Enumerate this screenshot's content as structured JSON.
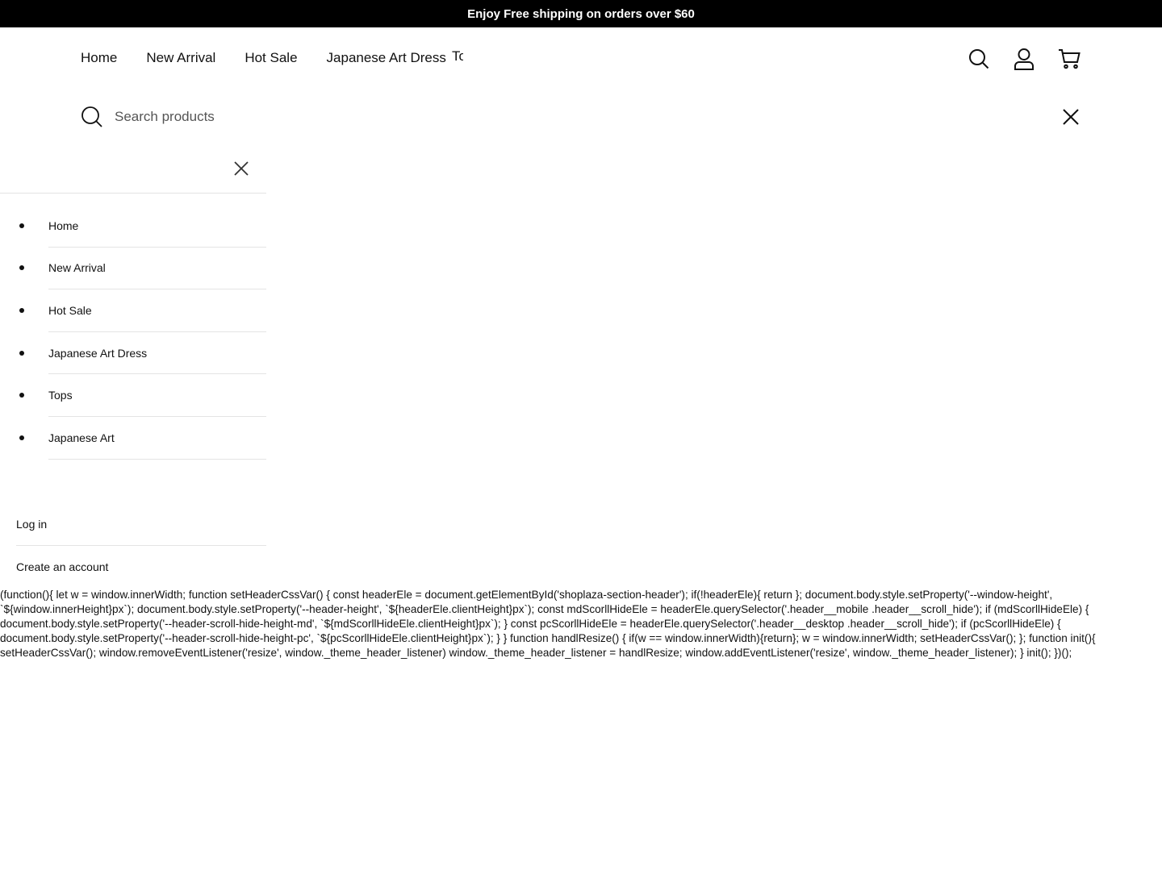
{
  "announcement": "Enjoy Free shipping on orders over $60",
  "nav": {
    "items": [
      "Home",
      "New Arrival",
      "Hot Sale",
      "Japanese Art Dress"
    ],
    "clipped_item": "Tops"
  },
  "header_icons": [
    "search-icon",
    "account-icon",
    "cart-icon"
  ],
  "search": {
    "placeholder": "Search products"
  },
  "drawer": {
    "menu": [
      "Home",
      "New Arrival",
      "Hot Sale",
      "Japanese Art Dress",
      "Tops",
      "Japanese Art"
    ],
    "account": {
      "login": "Log in",
      "register": "Create an account"
    }
  },
  "script_text": "(function(){ let w = window.innerWidth; function setHeaderCssVar() { const headerEle = document.getElementById('shoplaza-section-header'); if(!headerEle){ return }; document.body.style.setProperty('--window-height', `${window.innerHeight}px`); document.body.style.setProperty('--header-height', `${headerEle.clientHeight}px`); const mdScorllHideEle = headerEle.querySelector('.header__mobile .header__scroll_hide'); if (mdScorllHideEle) { document.body.style.setProperty('--header-scroll-hide-height-md', `${mdScorllHideEle.clientHeight}px`); } const pcScorllHideEle = headerEle.querySelector('.header__desktop .header__scroll_hide'); if (pcScorllHideEle) { document.body.style.setProperty('--header-scroll-hide-height-pc', `${pcScorllHideEle.clientHeight}px`); } } function handlResize() { if(w == window.innerWidth){return}; w = window.innerWidth; setHeaderCssVar(); }; function init(){ setHeaderCssVar(); window.removeEventListener('resize', window._theme_header_listener) window._theme_header_listener = handlResize; window.addEventListener('resize', window._theme_header_listener); } init(); })();"
}
